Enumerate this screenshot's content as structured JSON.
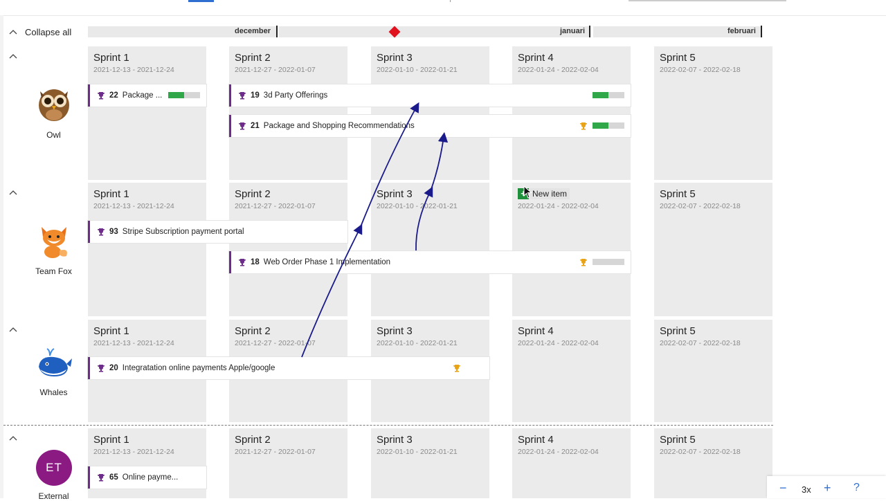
{
  "toolbar": {
    "collapse_all_label": "Collapse all"
  },
  "timeline": {
    "months": [
      {
        "label": "december"
      },
      {
        "label": "januari"
      },
      {
        "label": "februari"
      }
    ],
    "today_marker_color": "#e0121e"
  },
  "sprints": [
    {
      "name": "Sprint 1",
      "dates": "2021-12-13 - 2021-12-24"
    },
    {
      "name": "Sprint 2",
      "dates": "2021-12-27 - 2022-01-07"
    },
    {
      "name": "Sprint 3",
      "dates": "2022-01-10 - 2022-01-21"
    },
    {
      "name": "Sprint 4",
      "dates": "2022-01-24 - 2022-02-04"
    },
    {
      "name": "Sprint 5",
      "dates": "2022-02-07 - 2022-02-18"
    }
  ],
  "teams": [
    {
      "name": "Owl",
      "avatar": "owl-icon"
    },
    {
      "name": "Team Fox",
      "avatar": "fox-icon"
    },
    {
      "name": "Whales",
      "avatar": "whale-icon"
    },
    {
      "name": "External",
      "initials": "ET"
    }
  ],
  "features": [
    {
      "id": "22",
      "title": "Package ...",
      "progress": 0.5,
      "trophy_gold": false
    },
    {
      "id": "19",
      "title": "3d Party Offerings",
      "progress": 0.5,
      "trophy_gold": false
    },
    {
      "id": "21",
      "title": "Package and Shopping Recommendations",
      "progress": 0.5,
      "trophy_gold": true
    },
    {
      "id": "93",
      "title": "Stripe Subscription payment portal",
      "progress": null,
      "trophy_gold": false
    },
    {
      "id": "18",
      "title": "Web Order Phase 1 Implementation",
      "progress": 0.0,
      "trophy_gold": true
    },
    {
      "id": "20",
      "title": "Integratation online payments Apple/google",
      "progress": null,
      "trophy_gold": true
    },
    {
      "id": "65",
      "title": "Online payme...",
      "progress": null,
      "trophy_gold": false
    }
  ],
  "new_item": {
    "plus": "+",
    "label": "New item"
  },
  "zoom": {
    "minus": "−",
    "level": "3x",
    "plus": "+",
    "help": "?"
  },
  "colors": {
    "accent": "#2f6fd1",
    "feature_border": "#6d2c8a",
    "progress": "#30a84a",
    "trophy_gold": "#e8a317",
    "dependency": "#1a1a8a"
  }
}
